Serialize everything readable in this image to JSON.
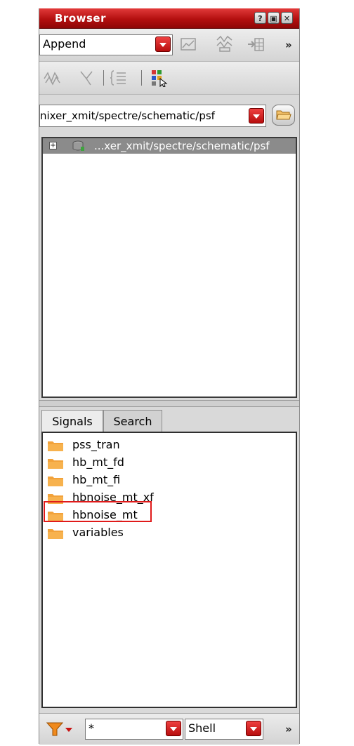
{
  "window": {
    "title": "Browser",
    "buttons": [
      "?",
      "▣",
      "✕"
    ]
  },
  "toolbar1": {
    "mode_value": "Append",
    "overflow_label": "»"
  },
  "toolbar2": {},
  "path": {
    "value": "nixer_xmit/spectre/schematic/psf"
  },
  "tree": {
    "items": [
      {
        "label": "...xer_xmit/spectre/schematic/psf",
        "expander": "+"
      }
    ]
  },
  "tabs": [
    {
      "label": "Signals",
      "active": true
    },
    {
      "label": "Search",
      "active": false
    }
  ],
  "signals": {
    "items": [
      {
        "label": "pss_tran"
      },
      {
        "label": "hb_mt_fd"
      },
      {
        "label": "hb_mt_fi"
      },
      {
        "label": "hbnoise_mt_xf"
      },
      {
        "label": "hbnoise_mt",
        "highlighted": true
      },
      {
        "label": "variables"
      }
    ]
  },
  "bottom": {
    "filter_value": "*",
    "shell_value": "Shell",
    "overflow_label": "»"
  },
  "colors": {
    "accent": "#c81414",
    "folder": "#f2a23a",
    "highlight": "#e01a1a"
  }
}
